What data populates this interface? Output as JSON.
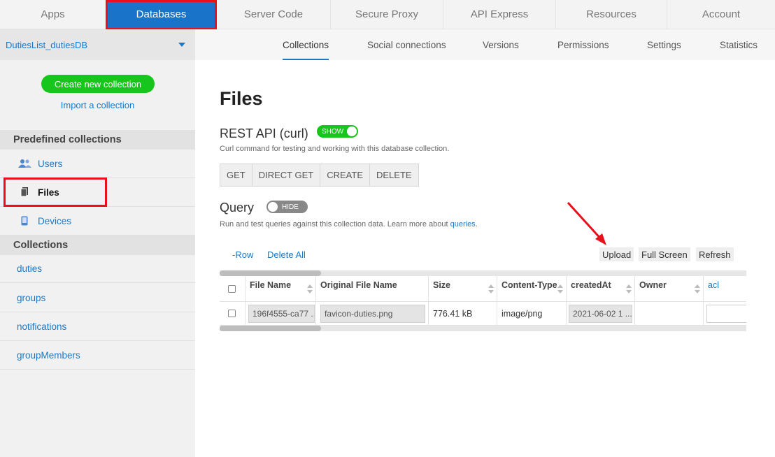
{
  "topnav": {
    "tabs": [
      {
        "label": "Apps",
        "name": "apps"
      },
      {
        "label": "Databases",
        "name": "databases",
        "active": true
      },
      {
        "label": "Server Code",
        "name": "server-code"
      },
      {
        "label": "Secure Proxy",
        "name": "secure-proxy"
      },
      {
        "label": "API Express",
        "name": "api-express"
      },
      {
        "label": "Resources",
        "name": "resources"
      },
      {
        "label": "Account",
        "name": "account"
      }
    ]
  },
  "sidebar": {
    "database_name": "DutiesList_dutiesDB",
    "create_label": "Create new collection",
    "import_label": "Import a collection",
    "predefined_header": "Predefined collections",
    "predefined": [
      {
        "label": "Users",
        "icon": "users-icon"
      },
      {
        "label": "Files",
        "icon": "files-icon",
        "active": true
      },
      {
        "label": "Devices",
        "icon": "device-icon"
      }
    ],
    "collections_header": "Collections",
    "collections": [
      "duties",
      "groups",
      "notifications",
      "groupMembers"
    ]
  },
  "subtabs": [
    "Collections",
    "Social connections",
    "Versions",
    "Permissions",
    "Settings",
    "Statistics"
  ],
  "main": {
    "title": "Files",
    "rest": {
      "title": "REST API (curl)",
      "toggle": "SHOW",
      "hint": "Curl command for testing and working with this database collection.",
      "buttons": [
        "GET",
        "DIRECT GET",
        "CREATE",
        "DELETE"
      ]
    },
    "query": {
      "title": "Query",
      "toggle": "HIDE",
      "hint": "Run and test queries against this collection data. Learn more about",
      "hint_link": "queries",
      "hint_end": "."
    },
    "actions": {
      "row": "-Row",
      "delete_all": "Delete All",
      "upload": "Upload",
      "full_screen": "Full Screen",
      "refresh": "Refresh"
    },
    "grid": {
      "columns": [
        "File Name",
        "Original File Name",
        "Size",
        "Content-Type",
        "createdAt",
        "Owner",
        "acl"
      ],
      "row": {
        "file_name": "196f4555-ca77 ...",
        "original_file_name": "favicon-duties.png",
        "size": "776.41 kB",
        "content_type": "image/png",
        "created_at": "2021-06-02 1 ...",
        "owner": "",
        "acl": ""
      }
    }
  },
  "colors": {
    "accent": "#1a78c8",
    "active_tab": "#1873c9",
    "green": "#16c61c",
    "highlight": "#e8101a"
  }
}
